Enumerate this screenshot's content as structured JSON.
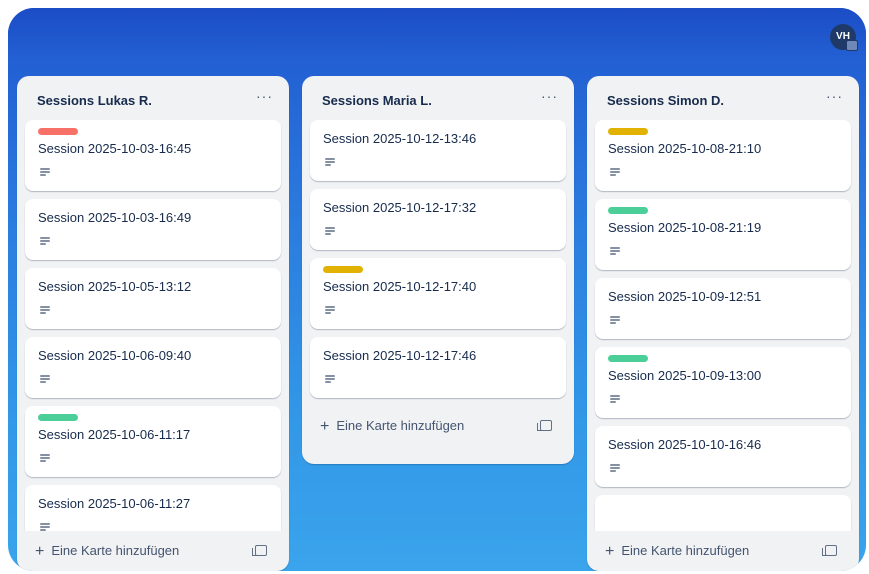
{
  "header": {
    "avatar_initials": "VH"
  },
  "colors": {
    "red": "#f87168",
    "yellow": "#e2b203",
    "green": "#4bce97"
  },
  "lists": [
    {
      "title": "Sessions Lukas R.",
      "menu": "···",
      "add_card": "Eine Karte hinzufügen",
      "cards": [
        {
          "title": "Session 2025-10-03-16:45",
          "label": "red"
        },
        {
          "title": "Session 2025-10-03-16:49"
        },
        {
          "title": "Session 2025-10-05-13:12"
        },
        {
          "title": "Session 2025-10-06-09:40"
        },
        {
          "title": "Session 2025-10-06-11:17",
          "label": "green"
        },
        {
          "title": "Session 2025-10-06-11:27"
        }
      ]
    },
    {
      "title": "Sessions Maria L.",
      "menu": "···",
      "add_card": "Eine Karte hinzufügen",
      "cards": [
        {
          "title": "Session 2025-10-12-13:46"
        },
        {
          "title": "Session 2025-10-12-17:32"
        },
        {
          "title": "Session 2025-10-12-17:40",
          "label": "yellow"
        },
        {
          "title": "Session 2025-10-12-17:46"
        }
      ]
    },
    {
      "title": "Sessions Simon D.",
      "menu": "···",
      "add_card": "Eine Karte hinzufügen",
      "cards": [
        {
          "title": "Session 2025-10-08-21:10",
          "label": "yellow"
        },
        {
          "title": "Session 2025-10-08-21:19",
          "label": "green"
        },
        {
          "title": "Session 2025-10-09-12:51"
        },
        {
          "title": "Session 2025-10-09-13:00",
          "label": "green"
        },
        {
          "title": "Session 2025-10-10-16:46"
        },
        {
          "title": ""
        }
      ]
    }
  ]
}
